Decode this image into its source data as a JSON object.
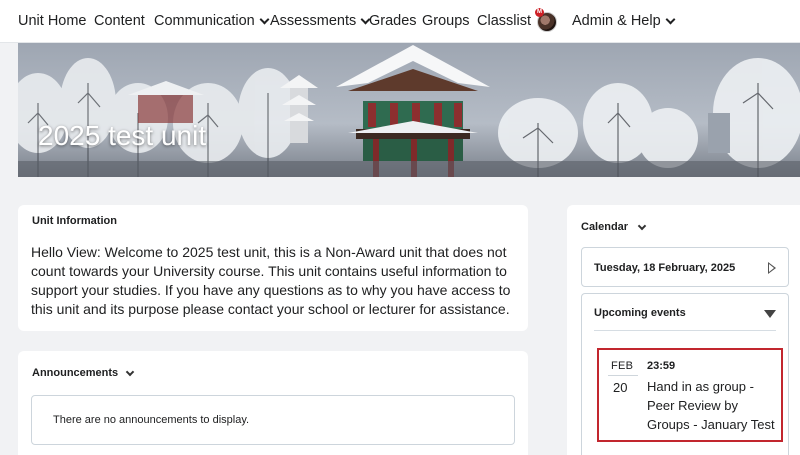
{
  "nav": {
    "items": [
      {
        "label": "Unit Home",
        "dropdown": false
      },
      {
        "label": "Content",
        "dropdown": false
      },
      {
        "label": "Communication",
        "dropdown": true
      },
      {
        "label": "Assessments",
        "dropdown": true
      },
      {
        "label": "Grades",
        "dropdown": false
      },
      {
        "label": "Groups",
        "dropdown": false
      },
      {
        "label": "Classlist",
        "dropdown": false
      }
    ],
    "avatar_badge": "M",
    "admin_label": "Admin & Help"
  },
  "banner": {
    "title": "2025 test unit"
  },
  "unit_info": {
    "heading": "Unit Information",
    "text": "Hello View: Welcome to 2025 test unit, this is a Non-Award unit that does not count towards your University course. This unit contains useful information to support your studies. If you have any questions as to why you have access to this unit and its purpose please contact your school or lecturer for assistance."
  },
  "announcements": {
    "heading": "Announcements",
    "empty_text": "There are no announcements to display."
  },
  "calendar": {
    "heading": "Calendar",
    "date": "Tuesday, 18 February, 2025",
    "upcoming_heading": "Upcoming events",
    "event": {
      "month": "FEB",
      "day": "20",
      "time": "23:59",
      "title": "Hand in as group - Peer Review by Groups - January Test"
    }
  },
  "colors": {
    "highlight_border": "#c2262e",
    "page_bg": "#f1f2f4"
  }
}
